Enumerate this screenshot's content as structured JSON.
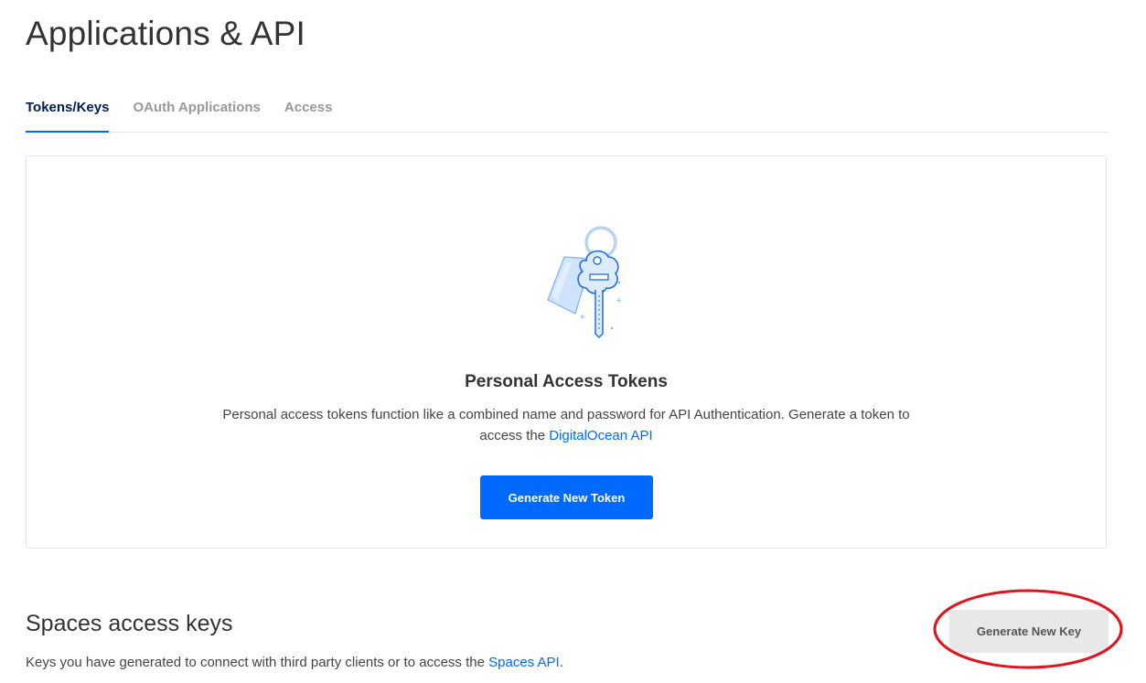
{
  "page": {
    "title": "Applications & API"
  },
  "tabs": [
    {
      "label": "Tokens/Keys",
      "active": true
    },
    {
      "label": "OAuth Applications",
      "active": false
    },
    {
      "label": "Access",
      "active": false
    }
  ],
  "tokens_card": {
    "icon": "key-with-tag-icon",
    "title": "Personal Access Tokens",
    "description_prefix": "Personal access tokens function like a combined name and password for API Authentication. Generate a token to access the ",
    "description_link": "DigitalOcean API",
    "button_label": "Generate New Token"
  },
  "spaces": {
    "title": "Spaces access keys",
    "description_prefix": "Keys you have generated to connect with third party clients or to access the ",
    "description_link": "Spaces API",
    "description_suffix": ".",
    "button_label": "Generate New Key"
  },
  "colors": {
    "accent": "#0069ff",
    "active_tab": "#031b4e",
    "highlight_ring": "#e0141e"
  }
}
